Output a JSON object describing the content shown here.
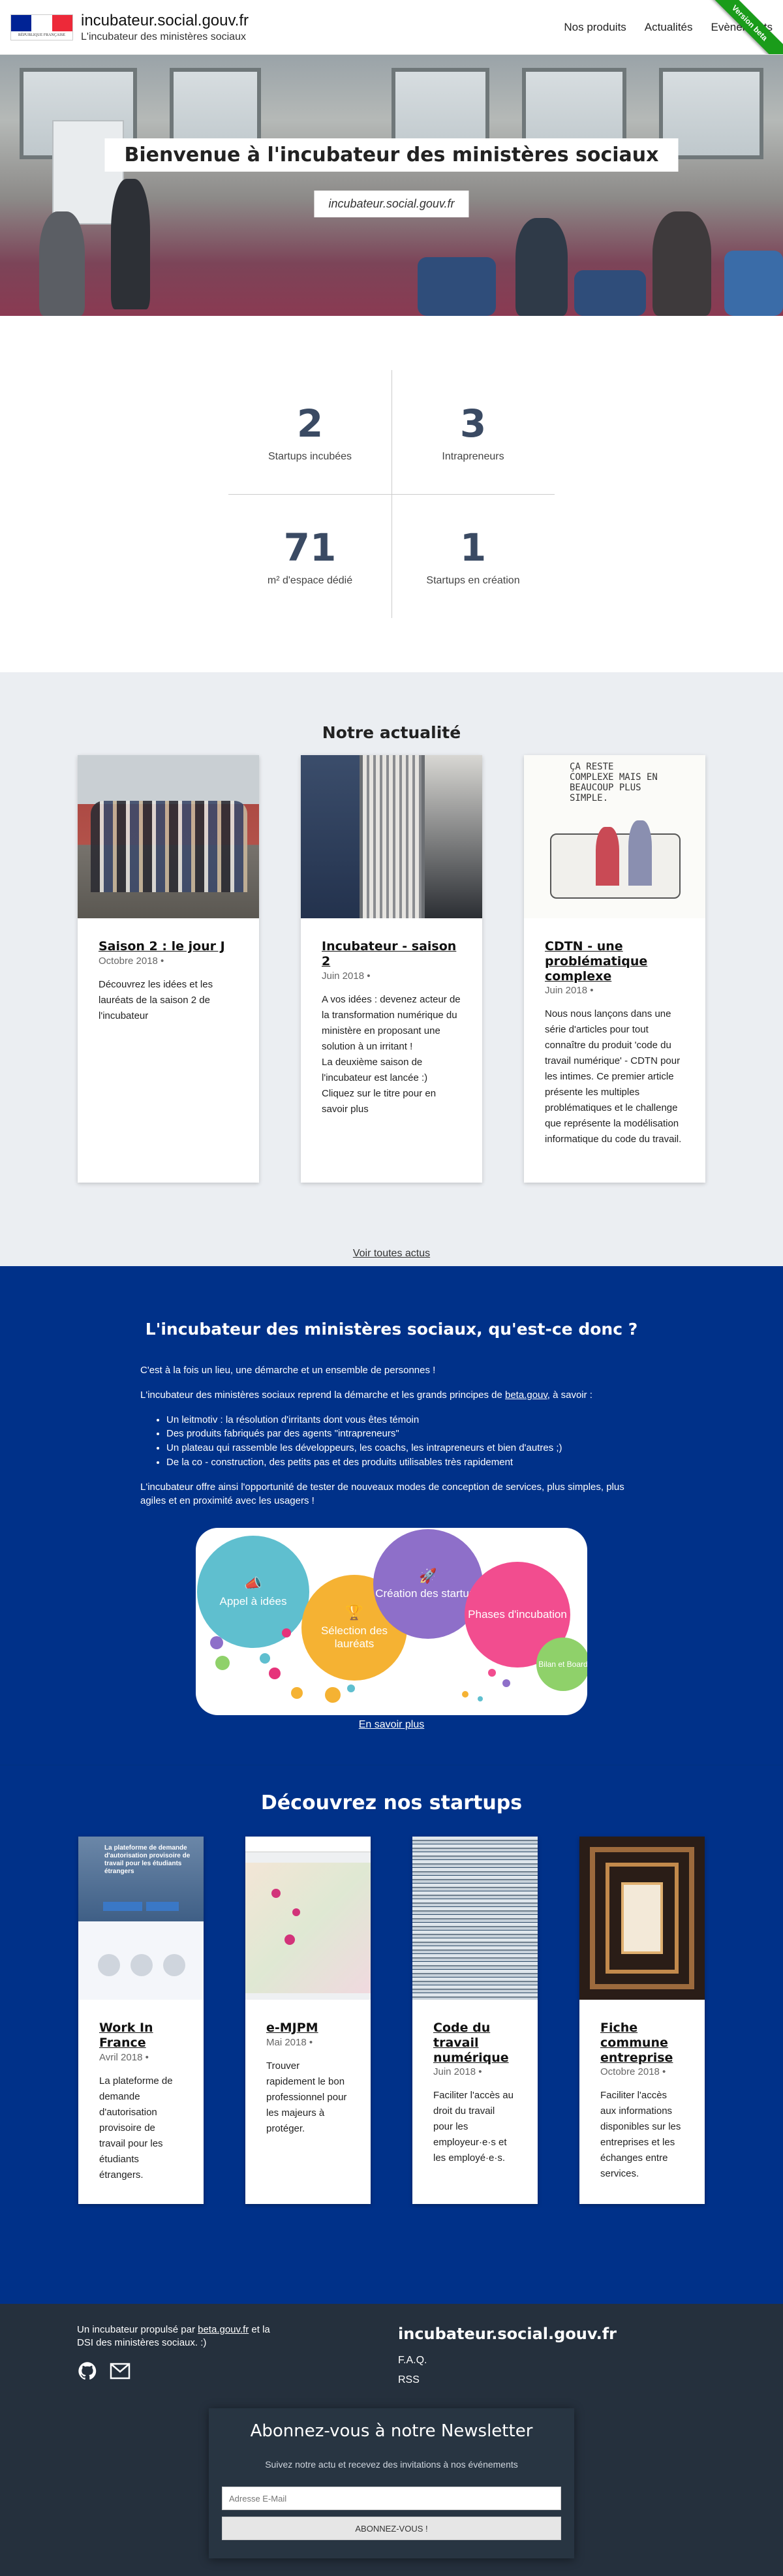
{
  "header": {
    "site_title": "incubateur.social.gouv.fr",
    "site_tagline": "L'incubateur des ministères sociaux",
    "logo_text": "RÉPUBLIQUE FRANÇAISE",
    "nav": [
      "Nos produits",
      "Actualités",
      "Evènements"
    ],
    "ribbon": "Version beta"
  },
  "hero": {
    "title": "Bienvenue à l'incubateur des ministères sociaux",
    "subtitle": "incubateur.social.gouv.fr"
  },
  "stats": [
    {
      "value": "2",
      "label": "Startups incubées"
    },
    {
      "value": "3",
      "label": "Intrapreneurs"
    },
    {
      "value": "71",
      "label": "m² d'espace dédié"
    },
    {
      "value": "1",
      "label": "Startups en création"
    }
  ],
  "news": {
    "title": "Notre actualité",
    "cards": [
      {
        "title": "Saison 2 : le jour J",
        "date": "Octobre 2018 •",
        "desc": "Découvrez les idées et les lauréats de la saison 2 de l'incubateur"
      },
      {
        "title": "Incubateur - saison 2",
        "date": "Juin 2018 •",
        "desc": "A vos idées : devenez acteur de la transformation numérique du ministère en proposant une solution à un irritant !\nLa deuxième saison de l'incubateur est lancée :)\nCliquez sur le titre pour en savoir plus"
      },
      {
        "title": "CDTN - une problématique complexe",
        "date": "Juin 2018 •",
        "desc": "Nous nous lançons dans une série d'articles pour tout connaître du produit 'code du travail numérique' - CDTN pour les intimes. Ce premier article présente les multiples problématiques et le challenge que représente la modélisation informatique du code du travail."
      }
    ],
    "cartoon_text": "ÇA RESTE COMPLEXE MAIS EN BEAUCOUP PLUS SIMPLE.",
    "more": "Voir toutes actus"
  },
  "about": {
    "title": "L'incubateur des ministères sociaux, qu'est-ce donc ?",
    "p1": "C'est à la fois un lieu, une démarche et un ensemble de personnes !",
    "p2_before": "L'incubateur des ministères sociaux reprend la démarche et les grands principes de ",
    "p2_link": "beta.gouv",
    "p2_after": ", à savoir :",
    "list": [
      "Un leitmotiv : la résolution d'irritants dont vous êtes témoin",
      "Des produits fabriqués par des agents \"intrapreneurs\"",
      "Un plateau qui rassemble les développeurs, les coachs, les intrapreneurs et bien d'autres ;)",
      "De la co - construction, des petits pas et des produits utilisables très rapidement"
    ],
    "p3": "L'incubateur offre ainsi l'opportunité de tester de nouveaux modes de conception de services, plus simples, plus agiles et en proximité avec les usagers !",
    "bubbles": [
      "Appel à idées",
      "Sélection des lauréats",
      "Création des startups",
      "Phases d'incubation",
      "Bilan et Board"
    ],
    "colors": {
      "appel": "#5fbfcf",
      "selection": "#f5b233",
      "creation": "#8e6fc9",
      "phases": "#f24d8f",
      "bilan": "#8fd16a"
    },
    "more": "En savoir plus"
  },
  "startups": {
    "title": "Découvrez nos startups",
    "cards": [
      {
        "title": "Work In France",
        "date": "Avril 2018 •",
        "desc": "La plateforme de demande d'autorisation provisoire de travail pour les étudiants étrangers."
      },
      {
        "title": "e-MJPM",
        "date": "Mai 2018 •",
        "desc": "Trouver rapidement le bon professionnel pour les majeurs à protéger."
      },
      {
        "title": "Code du travail numérique",
        "date": "Juin 2018 •",
        "desc": "Faciliter l'accès au droit du travail pour les employeur·e·s et les employé·e·s."
      },
      {
        "title": "Fiche commune entreprise",
        "date": "Octobre 2018 •",
        "desc": "Faciliter l'accès aux informations disponibles sur les entreprises et les échanges entre services."
      }
    ],
    "wif_banner": "La plateforme de demande d'autorisation provisoire de travail pour les étudiants étrangers"
  },
  "footer": {
    "intro_before": "Un incubateur propulsé par ",
    "intro_link": "beta.gouv.fr",
    "intro_after": " et la DSI des ministères sociaux. :)",
    "brand": "incubateur.social.gouv.fr",
    "links": [
      "F.A.Q.",
      "RSS"
    ],
    "newsletter": {
      "title": "Abonnez-vous à notre Newsletter",
      "subtitle": "Suivez notre actu et recevez des invitations à nos événements",
      "placeholder": "Adresse E-Mail",
      "button": "ABONNEZ-VOUS !"
    }
  }
}
